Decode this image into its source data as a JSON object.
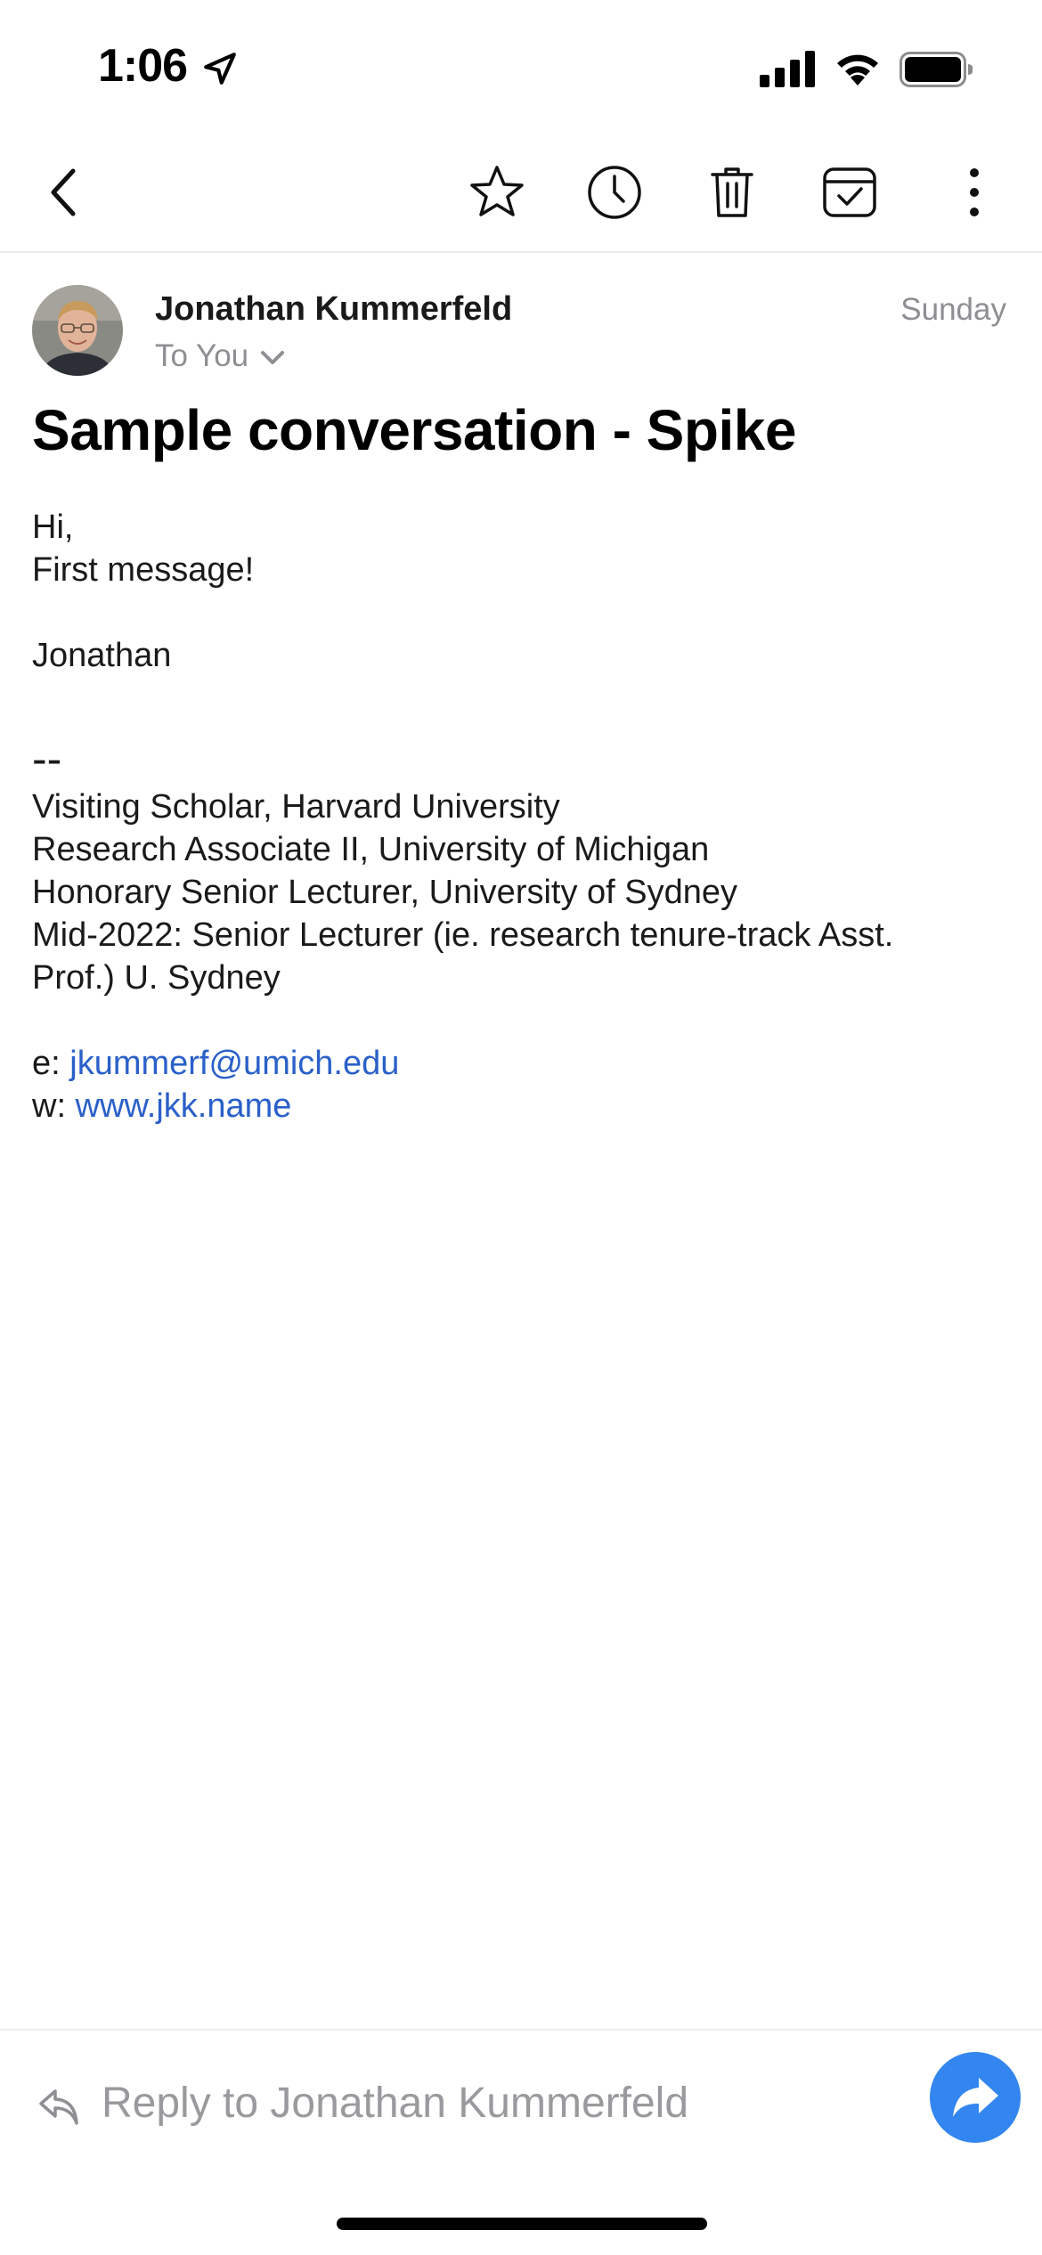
{
  "status_bar": {
    "time": "1:06"
  },
  "toolbar": {
    "icons": [
      "back-chevron-icon",
      "star-icon",
      "clock-icon",
      "trash-icon",
      "calendar-check-icon",
      "more-vertical-icon"
    ]
  },
  "email": {
    "sender": "Jonathan Kummerfeld",
    "recipient": "To You",
    "date": "Sunday",
    "subject": "Sample conversation - Spike",
    "body": {
      "greeting": "Hi,",
      "message": "First message!",
      "signoff": "Jonathan",
      "sig_dash": "--",
      "sig_lines": [
        "Visiting Scholar, Harvard University",
        "Research Associate II, University of Michigan",
        "Honorary Senior Lecturer, University of Sydney",
        "Mid-2022: Senior Lecturer (ie. research tenure-track Asst.",
        "Prof.) U. Sydney"
      ],
      "email_prefix": "e: ",
      "email_link": "jkummerf@umich.edu",
      "web_prefix": "w: ",
      "web_link": "www.jkk.name"
    }
  },
  "reply": {
    "placeholder": "Reply to Jonathan Kummerfeld"
  },
  "colors": {
    "link": "#2a60c9",
    "send_button": "#3385f0",
    "secondary_text": "#8e8e93"
  }
}
